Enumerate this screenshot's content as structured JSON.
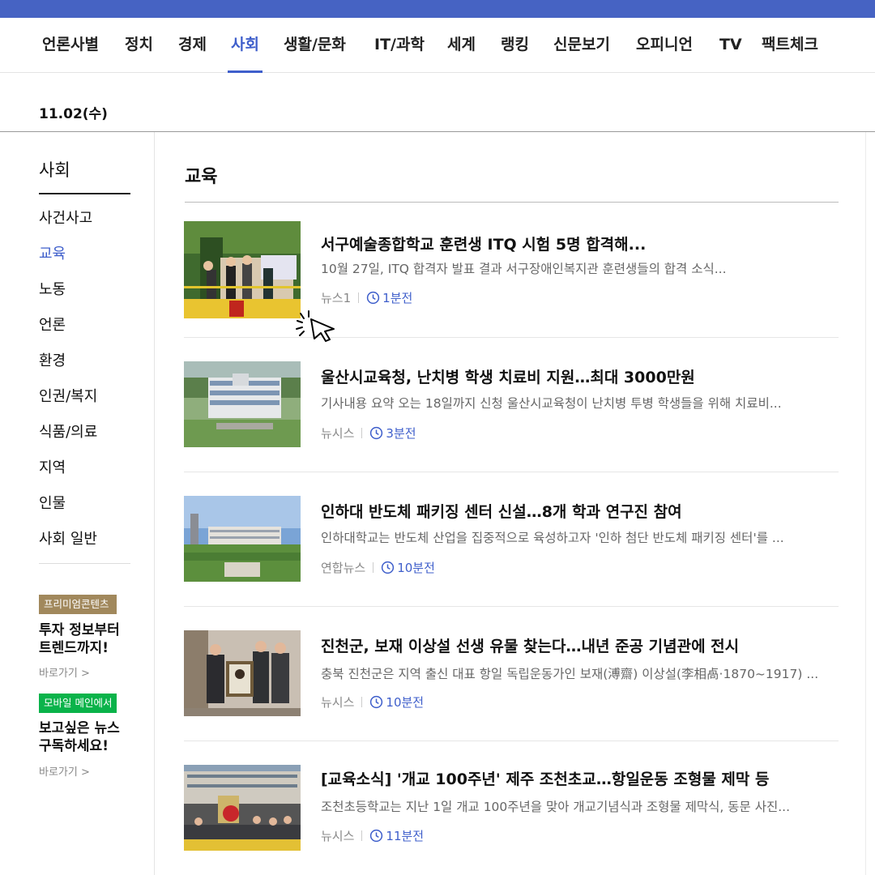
{
  "nav": {
    "items": [
      "언론사별",
      "정치",
      "경제",
      "사회",
      "생활/문화",
      "IT/과학",
      "세계",
      "랭킹",
      "신문보기",
      "오피니언",
      "TV",
      "팩트체크"
    ],
    "active_index": 3
  },
  "date": "11.02(수)",
  "lnb": {
    "title": "사회",
    "items": [
      "사건사고",
      "교육",
      "노동",
      "언론",
      "환경",
      "인권/복지",
      "식품/의료",
      "지역",
      "인물",
      "사회 일반"
    ],
    "active_index": 1
  },
  "promos": [
    {
      "badge": "프리미엄콘텐츠",
      "text": "투자 정보부터 트렌드까지!",
      "link": "바로가기 >"
    },
    {
      "badge": "모바일 메인에서",
      "text": "보고싶은 뉴스 구독하세요!",
      "link": "바로가기 >"
    }
  ],
  "section": {
    "title": "교육"
  },
  "articles": [
    {
      "title": "서구예술종합학교 훈련생 ITQ 시험 5명 합격해...",
      "summary": "10월 27일, ITQ 합격자 발표 결과 서구장애인복지관 훈련생들의 합격 소식...",
      "source": "뉴스1",
      "time": "1분전"
    },
    {
      "title": "울산시교육청, 난치병 학생 치료비 지원…최대 3000만원",
      "summary": "기사내용 요약 오는 18일까지 신청 울산시교육청이 난치병 투병 학생들을 위해 치료비...",
      "source": "뉴시스",
      "time": "3분전"
    },
    {
      "title": "인하대 반도체 패키징 센터 신설…8개 학과 연구진 참여",
      "summary": "인하대학교는 반도체 산업을 집중적으로 육성하고자 '인하 첨단 반도체 패키징 센터'를 ...",
      "source": "연합뉴스",
      "time": "10분전"
    },
    {
      "title": "진천군, 보재 이상설 선생 유물 찾는다…내년 준공 기념관에 전시",
      "summary": "충북 진천군은 지역 출신 대표 항일 독립운동가인 보재(溥齋) 이상설(李相卨·1870~1917) ...",
      "source": "뉴시스",
      "time": "10분전"
    },
    {
      "title": "[교육소식] '개교 100주년' 제주 조천초교…항일운동 조형물 제막 등",
      "summary": "조천초등학교는 지난 1일 개교 100주년을 맞아 개교기념식과 조형물 제막식, 동문 사진...",
      "source": "뉴시스",
      "time": "11분전"
    }
  ],
  "colors": {
    "accent": "#3f5fcb",
    "topbar": "#4663c3",
    "premium": "#a1885c",
    "mobile": "#0ab34a"
  },
  "icons": {
    "time": "clock-icon",
    "pointer": "hand-pointer-icon"
  }
}
